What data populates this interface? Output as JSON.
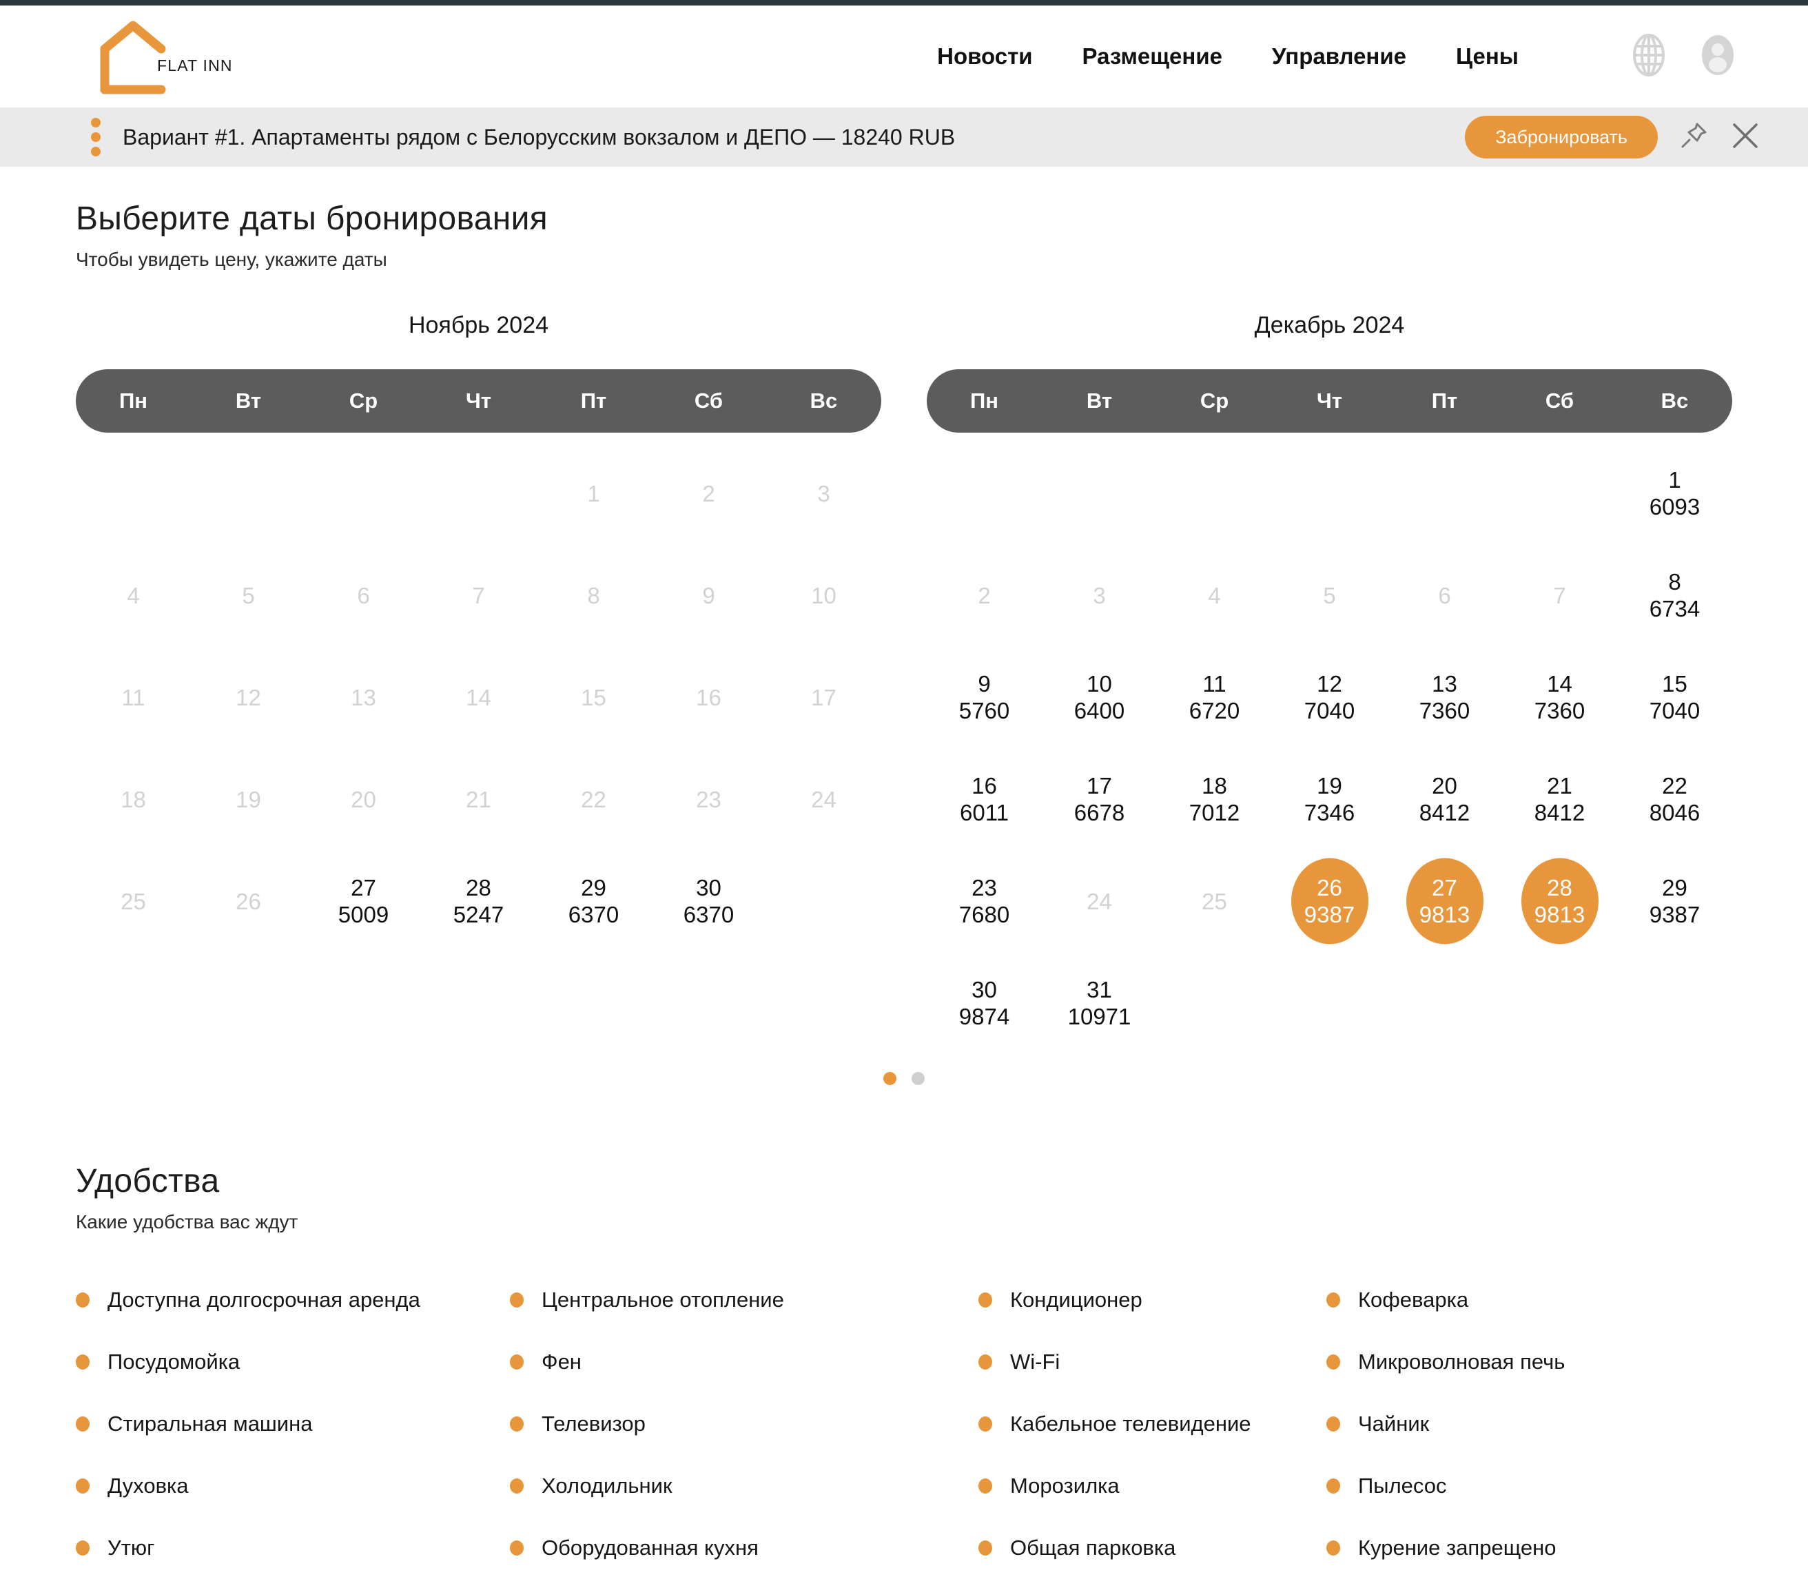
{
  "theme": {
    "accent": "#e8963c",
    "header_bar": "#2b3840",
    "offer_bg": "#eaeaea",
    "weekhead_bg": "#5c5c5c",
    "disabled_text": "#d2d2d2"
  },
  "header": {
    "logo_text": "FLAT INN",
    "nav": [
      {
        "label": "Новости",
        "name": "nav-news"
      },
      {
        "label": "Размещение",
        "name": "nav-placement"
      },
      {
        "label": "Управление",
        "name": "nav-management"
      },
      {
        "label": "Цены",
        "name": "nav-prices"
      }
    ],
    "icons": [
      {
        "name": "globe-icon",
        "label": "globe-icon"
      },
      {
        "name": "avatar-icon",
        "label": "avatar-icon"
      }
    ]
  },
  "offer_bar": {
    "drag_handle": "drag-dots-icon",
    "text": "Вариант #1. Апартаменты рядом с Белорусским вокзалом и ДЕПО — 18240 RUB",
    "book_label": "Забронировать",
    "pin_icon": "pin-icon",
    "close_icon": "close-icon"
  },
  "booking": {
    "title": "Выберите даты бронирования",
    "subtitle": "Чтобы увидеть цену, укажите даты",
    "weekdays": [
      "Пн",
      "Вт",
      "Ср",
      "Чт",
      "Пт",
      "Сб",
      "Вс"
    ],
    "pagination": {
      "total": 2,
      "current": 1
    },
    "calendars": [
      {
        "title": "Ноябрь 2024",
        "lead_blanks": 4,
        "days": [
          {
            "day": 1,
            "price": null,
            "state": "disabled"
          },
          {
            "day": 2,
            "price": null,
            "state": "disabled"
          },
          {
            "day": 3,
            "price": null,
            "state": "disabled"
          },
          {
            "day": 4,
            "price": null,
            "state": "disabled"
          },
          {
            "day": 5,
            "price": null,
            "state": "disabled"
          },
          {
            "day": 6,
            "price": null,
            "state": "disabled"
          },
          {
            "day": 7,
            "price": null,
            "state": "disabled"
          },
          {
            "day": 8,
            "price": null,
            "state": "disabled"
          },
          {
            "day": 9,
            "price": null,
            "state": "disabled"
          },
          {
            "day": 10,
            "price": null,
            "state": "disabled"
          },
          {
            "day": 11,
            "price": null,
            "state": "disabled"
          },
          {
            "day": 12,
            "price": null,
            "state": "disabled"
          },
          {
            "day": 13,
            "price": null,
            "state": "disabled"
          },
          {
            "day": 14,
            "price": null,
            "state": "disabled"
          },
          {
            "day": 15,
            "price": null,
            "state": "disabled"
          },
          {
            "day": 16,
            "price": null,
            "state": "disabled"
          },
          {
            "day": 17,
            "price": null,
            "state": "disabled"
          },
          {
            "day": 18,
            "price": null,
            "state": "disabled"
          },
          {
            "day": 19,
            "price": null,
            "state": "disabled"
          },
          {
            "day": 20,
            "price": null,
            "state": "disabled"
          },
          {
            "day": 21,
            "price": null,
            "state": "disabled"
          },
          {
            "day": 22,
            "price": null,
            "state": "disabled"
          },
          {
            "day": 23,
            "price": null,
            "state": "disabled"
          },
          {
            "day": 24,
            "price": null,
            "state": "disabled"
          },
          {
            "day": 25,
            "price": null,
            "state": "disabled"
          },
          {
            "day": 26,
            "price": null,
            "state": "disabled"
          },
          {
            "day": 27,
            "price": 5009,
            "state": "active"
          },
          {
            "day": 28,
            "price": 5247,
            "state": "active"
          },
          {
            "day": 29,
            "price": 6370,
            "state": "active"
          },
          {
            "day": 30,
            "price": 6370,
            "state": "active"
          }
        ]
      },
      {
        "title": "Декабрь 2024",
        "lead_blanks": 6,
        "days": [
          {
            "day": 1,
            "price": 6093,
            "state": "active"
          },
          {
            "day": 2,
            "price": null,
            "state": "disabled"
          },
          {
            "day": 3,
            "price": null,
            "state": "disabled"
          },
          {
            "day": 4,
            "price": null,
            "state": "disabled"
          },
          {
            "day": 5,
            "price": null,
            "state": "disabled"
          },
          {
            "day": 6,
            "price": null,
            "state": "disabled"
          },
          {
            "day": 7,
            "price": null,
            "state": "disabled"
          },
          {
            "day": 8,
            "price": 6734,
            "state": "active"
          },
          {
            "day": 9,
            "price": 5760,
            "state": "active"
          },
          {
            "day": 10,
            "price": 6400,
            "state": "active"
          },
          {
            "day": 11,
            "price": 6720,
            "state": "active"
          },
          {
            "day": 12,
            "price": 7040,
            "state": "active"
          },
          {
            "day": 13,
            "price": 7360,
            "state": "active"
          },
          {
            "day": 14,
            "price": 7360,
            "state": "active"
          },
          {
            "day": 15,
            "price": 7040,
            "state": "active"
          },
          {
            "day": 16,
            "price": 6011,
            "state": "active"
          },
          {
            "day": 17,
            "price": 6678,
            "state": "active"
          },
          {
            "day": 18,
            "price": 7012,
            "state": "active"
          },
          {
            "day": 19,
            "price": 7346,
            "state": "active"
          },
          {
            "day": 20,
            "price": 8412,
            "state": "active"
          },
          {
            "day": 21,
            "price": 8412,
            "state": "active"
          },
          {
            "day": 22,
            "price": 8046,
            "state": "active"
          },
          {
            "day": 23,
            "price": 7680,
            "state": "active"
          },
          {
            "day": 24,
            "price": null,
            "state": "disabled"
          },
          {
            "day": 25,
            "price": null,
            "state": "disabled"
          },
          {
            "day": 26,
            "price": 9387,
            "state": "selected"
          },
          {
            "day": 27,
            "price": 9813,
            "state": "selected"
          },
          {
            "day": 28,
            "price": 9813,
            "state": "selected"
          },
          {
            "day": 29,
            "price": 9387,
            "state": "active"
          },
          {
            "day": 30,
            "price": 9874,
            "state": "active"
          },
          {
            "day": 31,
            "price": 10971,
            "state": "active"
          }
        ]
      }
    ]
  },
  "amenities": {
    "title": "Удобства",
    "subtitle": "Какие удобства вас ждут",
    "columns": [
      [
        "Доступна долгосрочная аренда",
        "Посудомойка",
        "Стиральная машина",
        "Духовка",
        "Утюг"
      ],
      [
        "Центральное отопление",
        "Фен",
        "Телевизор",
        "Холодильник",
        "Оборудованная кухня"
      ],
      [
        "Кондиционер",
        "Wi-Fi",
        "Кабельное телевидение",
        "Морозилка",
        "Общая парковка"
      ],
      [
        "Кофеварка",
        "Микроволновая печь",
        "Чайник",
        "Пылесос",
        "Курение запрещено"
      ]
    ]
  }
}
